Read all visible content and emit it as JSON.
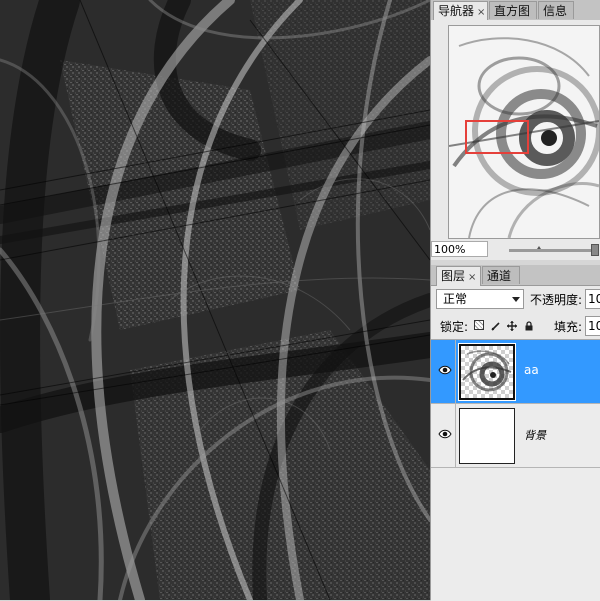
{
  "navigator_panel": {
    "tabs": [
      {
        "label": "导航器",
        "close": "×"
      },
      {
        "label": "直方图"
      },
      {
        "label": "信息"
      }
    ],
    "zoom_value": "100%"
  },
  "layers_panel": {
    "tabs": [
      {
        "label": "图层",
        "close": "×"
      },
      {
        "label": "通道"
      }
    ],
    "blend_mode": "正常",
    "opacity_label": "不透明度:",
    "opacity_value": "10",
    "lock_label": "锁定:",
    "lock_icons": [
      "lock-transparent-icon",
      "lock-image-icon",
      "lock-position-icon",
      "lock-all-icon"
    ],
    "fill_label": "填充:",
    "fill_value": "10",
    "layers": [
      {
        "name": "aa",
        "selected": true,
        "visible": true,
        "icon": "eye-icon"
      },
      {
        "name": "背景",
        "selected": false,
        "visible": true,
        "icon": "eye-icon"
      }
    ]
  },
  "colors": {
    "selection": "#3399ff",
    "nav_view_box": "#e5403a",
    "panel_bg": "#e9e9e9"
  }
}
